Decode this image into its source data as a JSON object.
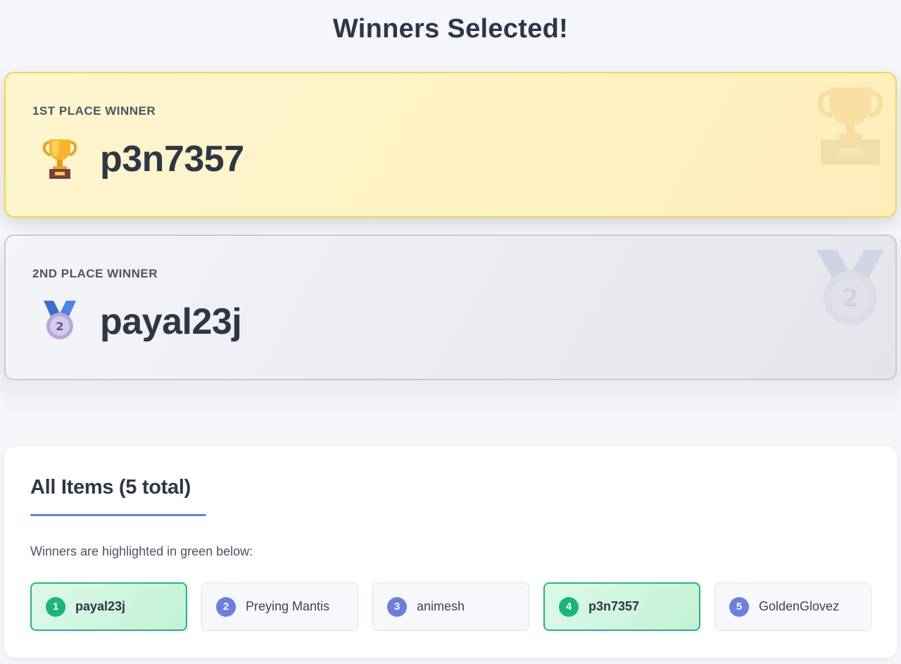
{
  "page": {
    "title": "Winners Selected!"
  },
  "winners": [
    {
      "label": "1st Place Winner",
      "name": "p3n7357",
      "icon": "trophy-icon",
      "accent": "#f2d84a"
    },
    {
      "label": "2nd Place Winner",
      "name": "payal23j",
      "icon": "second-place-medal-icon",
      "accent": "#c9cbd1"
    }
  ],
  "items_panel": {
    "title": "All Items (5 total)",
    "subtitle": "Winners are highlighted in green below:",
    "items": [
      {
        "number": "1",
        "name": "payal23j",
        "winner": true
      },
      {
        "number": "2",
        "name": "Preying Mantis",
        "winner": false
      },
      {
        "number": "3",
        "name": "animesh",
        "winner": false
      },
      {
        "number": "4",
        "name": "p3n7357",
        "winner": true
      },
      {
        "number": "5",
        "name": "GoldenGlovez",
        "winner": false
      }
    ]
  },
  "colors": {
    "winner_green": "#18b67c",
    "number_badge": "#6b7fe0",
    "accent_underline": "#667eea",
    "gold_border": "#f2d84a"
  }
}
